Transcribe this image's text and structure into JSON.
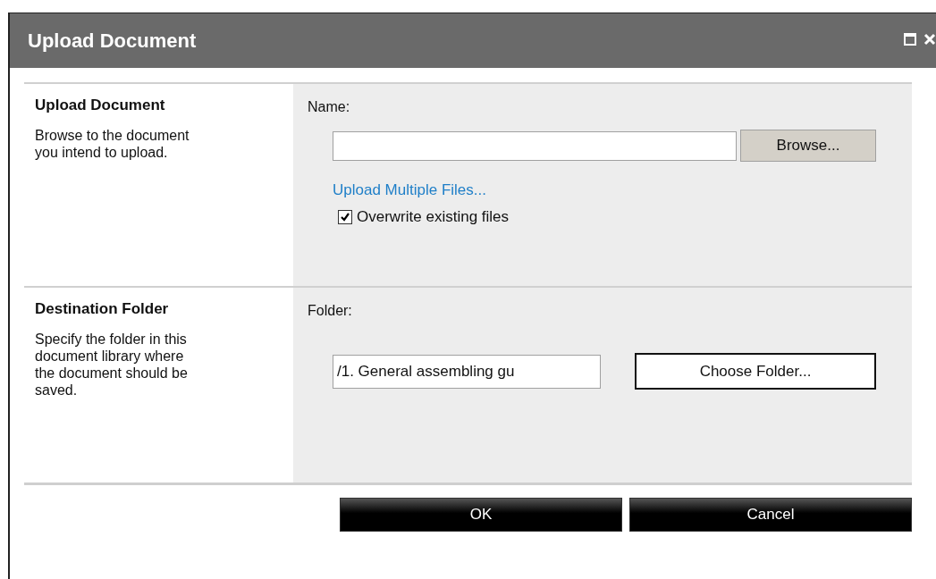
{
  "window": {
    "title": "Upload Document"
  },
  "sections": [
    {
      "title": "Upload Document",
      "description": "Browse to the document you intend to upload.",
      "field_label": "Name:",
      "kind": "file",
      "button": "Browse...",
      "link": "Upload Multiple Files...",
      "checkbox": {
        "label": "Overwrite existing files",
        "checked": true
      }
    },
    {
      "title": "Destination Folder",
      "description": "Specify the folder in this document library where the document should be saved.",
      "field_label": "Folder:",
      "kind": "folder",
      "value": "/1. General assembling gu",
      "button": "Choose Folder..."
    }
  ],
  "buttons": [
    "OK",
    "Cancel"
  ]
}
